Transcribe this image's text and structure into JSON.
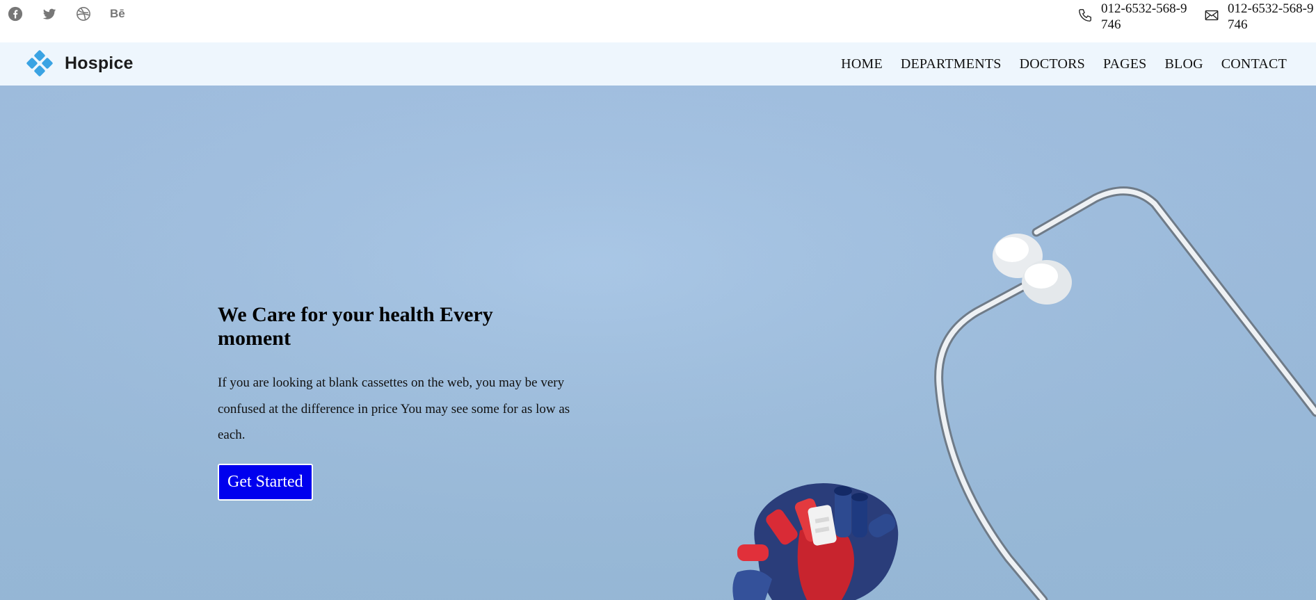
{
  "topbar": {
    "social": [
      {
        "icon": "facebook-icon"
      },
      {
        "icon": "twitter-icon"
      },
      {
        "icon": "dribbble-icon"
      },
      {
        "icon": "behance-icon",
        "label": "Bē"
      }
    ],
    "phone": {
      "icon": "phone-icon",
      "text": "012-6532-568-9746"
    },
    "email": {
      "icon": "mail-icon",
      "text": "012-6532-568-9746"
    }
  },
  "header": {
    "brand": "Hospice",
    "brand_color": "#3aa3e3",
    "nav": [
      "HOME",
      "DEPARTMENTS",
      "DOCTORS",
      "PAGES",
      "BLOG",
      "CONTACT"
    ]
  },
  "hero": {
    "title": "We Care for your health Every moment",
    "text": "If you are looking at blank cassettes on the web, you may be very confused at the difference in price You may see some for as low as each.",
    "button_label": "Get Started",
    "button_color": "#0000ee",
    "background_color": "#a0c0e3"
  }
}
